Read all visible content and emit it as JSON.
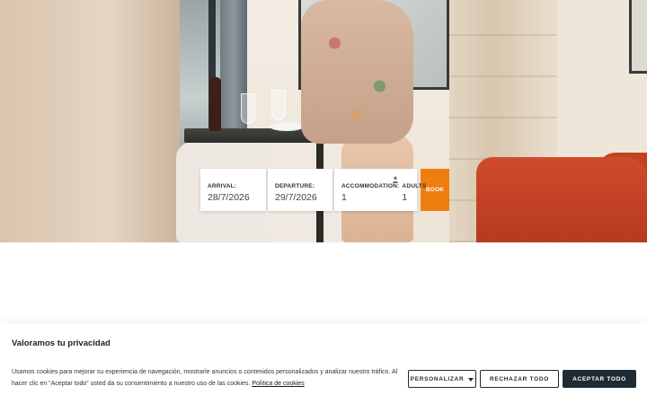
{
  "booking": {
    "arrival_label": "ARRIVAL:",
    "arrival_value": "28/7/2026",
    "departure_label": "DEPARTURE:",
    "departure_value": "29/7/2026",
    "accommodation_label": "ACCOMMODATION:",
    "accommodation_value": "1",
    "adults_label": "ADULTS",
    "adults_value": "1",
    "adults_icon": "person-icon",
    "book_label": "BOOK",
    "book_color": "#f07e0f"
  },
  "cookie_banner": {
    "title": "Valoramos tu privacidad",
    "message": "Usamos cookies para mejorar su experiencia de navegación, mostrarle anuncios o contenidos personalizados y analizar nuestro tráfico. Al hacer clic en “Aceptar todo” usted da su consentimiento a nuestro uso de las cookies.",
    "policy_link": "Política de cookies",
    "customize_label": "PERSONALIZAR",
    "customize_icon": "chevron-down-icon",
    "reject_label": "RECHAZAR TODO",
    "accept_label": "ACEPTAR TODO",
    "accent_color": "#1f2b33"
  }
}
